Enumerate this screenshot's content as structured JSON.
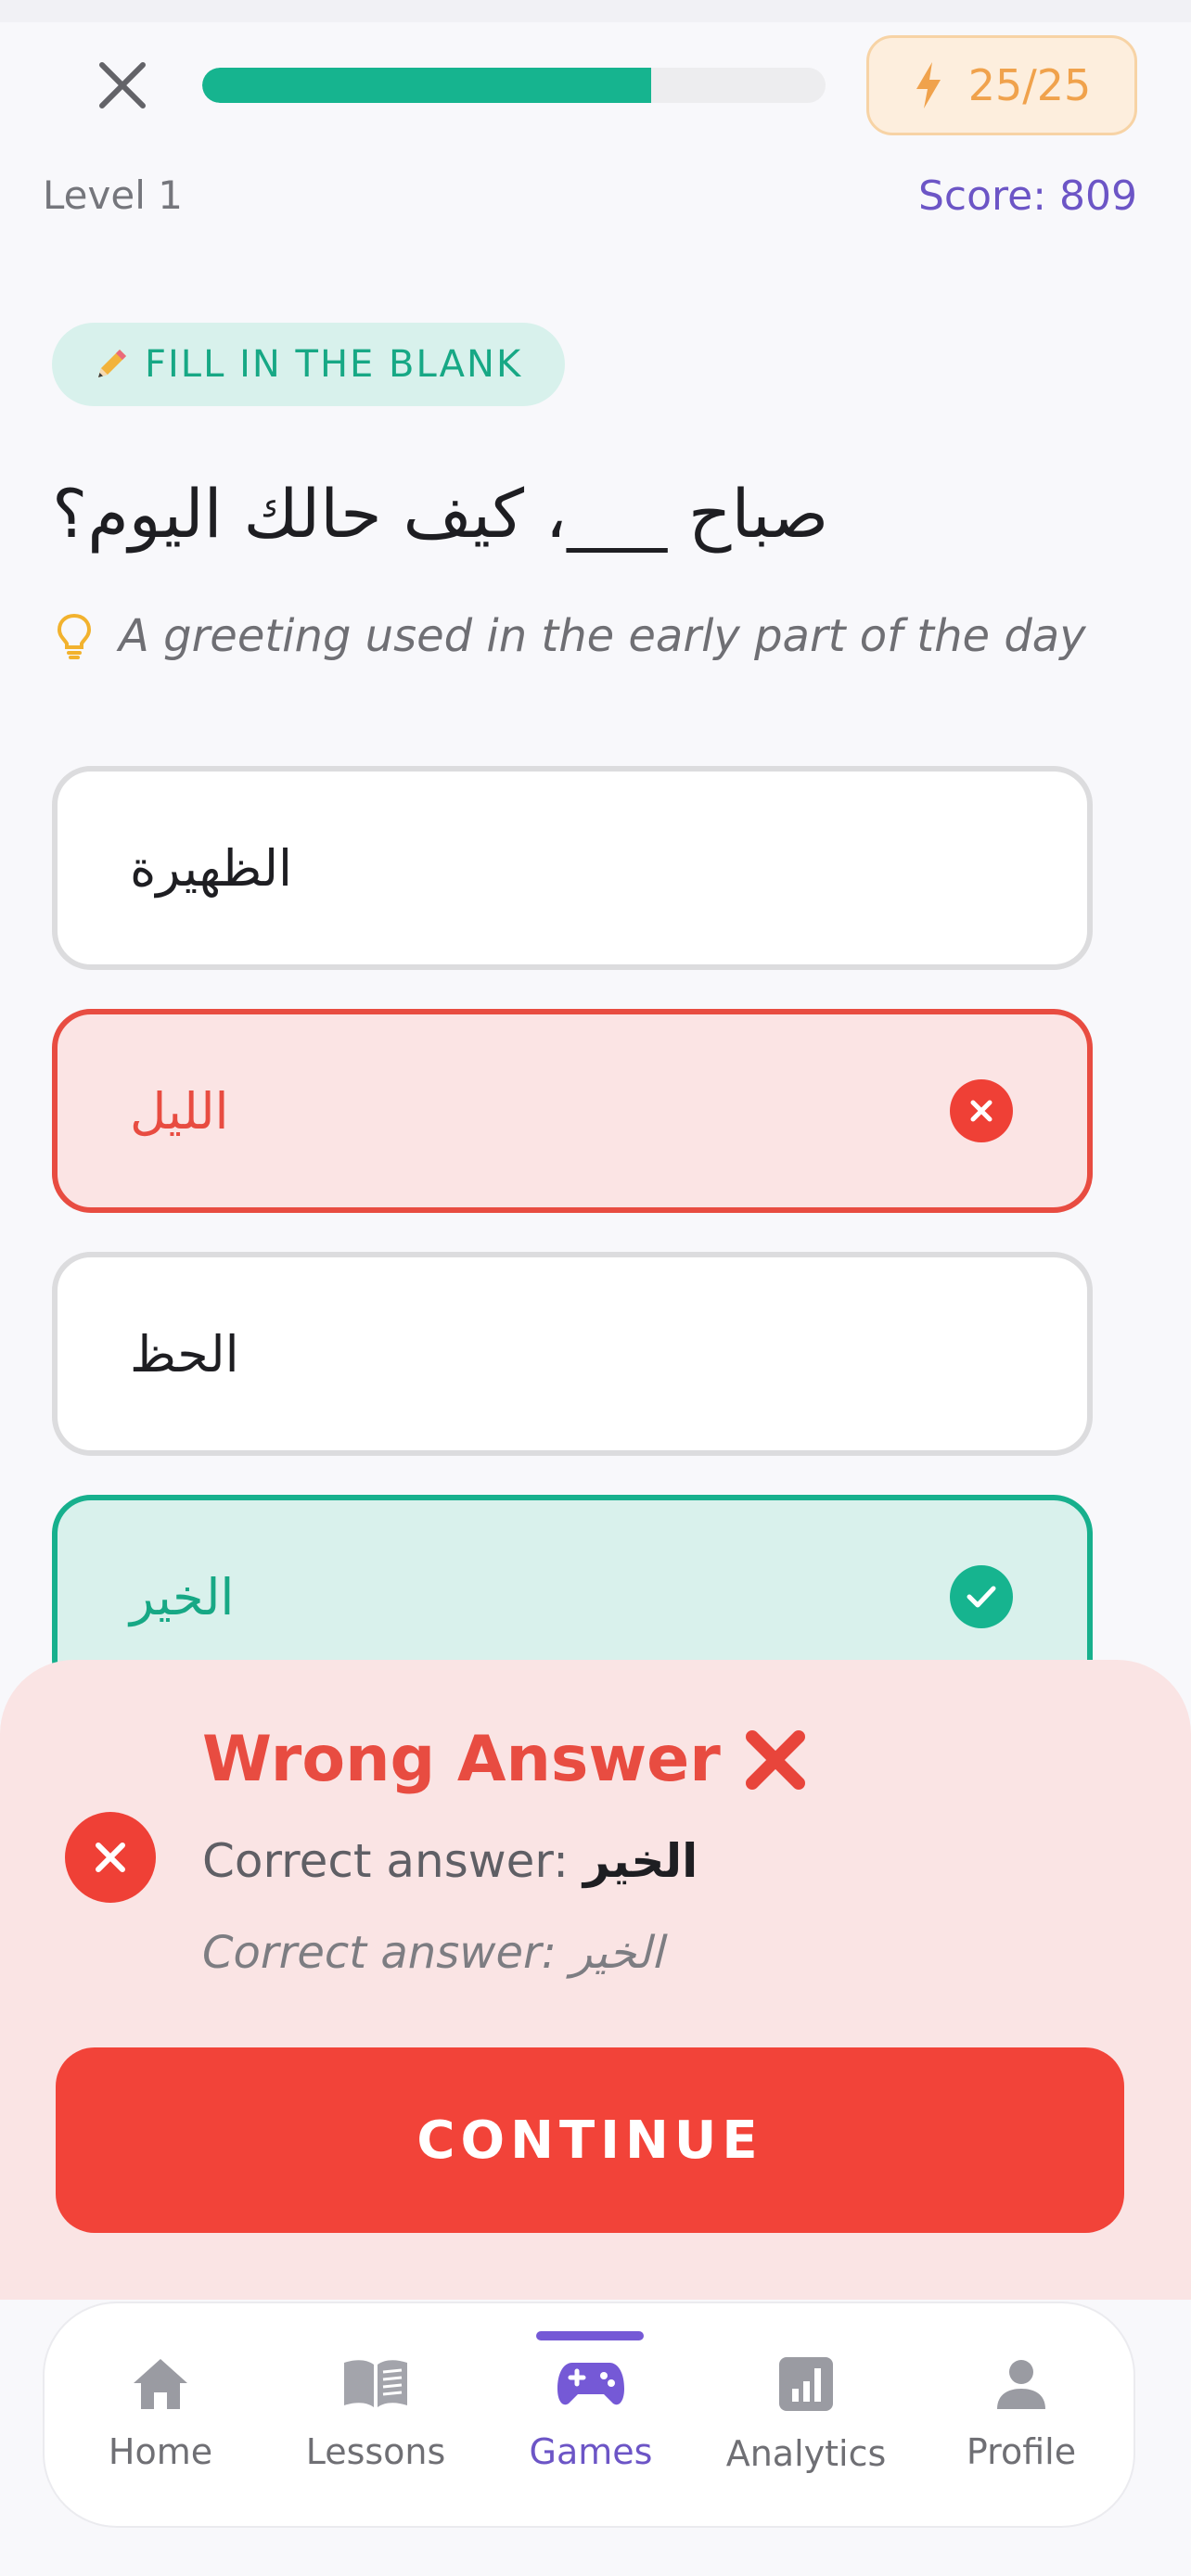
{
  "header": {
    "close_icon": "close-icon",
    "progress": 0.72,
    "energy": "25/25",
    "level": "Level 1",
    "score": "Score: 809"
  },
  "exercise": {
    "tag": "FILL IN THE BLANK",
    "tag_icon": "pencil-icon",
    "question": "صباح ___، كيف حالك اليوم؟",
    "hint": "A greeting used in the early part of the day",
    "options": [
      {
        "label": "الظهيرة",
        "state": "default"
      },
      {
        "label": "الليل",
        "state": "wrong"
      },
      {
        "label": "الحظ",
        "state": "default"
      },
      {
        "label": "الخير",
        "state": "correct"
      }
    ]
  },
  "feedback": {
    "title": "Wrong Answer",
    "title_emoji": "❌",
    "correct_prefix": "Correct answer:",
    "correct_value": "الخير",
    "secondary": "Correct answer: الخير",
    "continue_label": "CONTINUE"
  },
  "nav": {
    "items": [
      {
        "label": "Home",
        "icon": "home-icon"
      },
      {
        "label": "Lessons",
        "icon": "book-icon"
      },
      {
        "label": "Games",
        "icon": "gamepad-icon",
        "active": true
      },
      {
        "label": "Analytics",
        "icon": "analytics-icon"
      },
      {
        "label": "Profile",
        "icon": "profile-icon"
      }
    ]
  },
  "colors": {
    "accent": "#16b48f",
    "error": "#ef4036",
    "primary": "#6c55c6",
    "energy": "#f0a24c"
  }
}
